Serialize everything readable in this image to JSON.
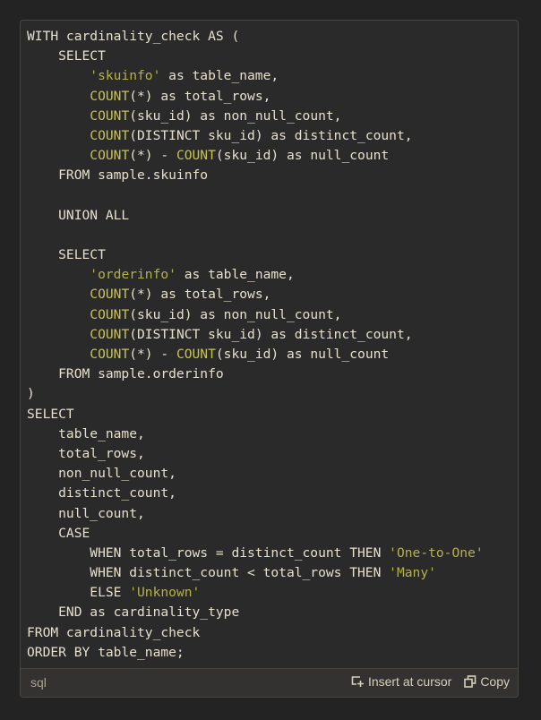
{
  "code_block": {
    "language": "sql",
    "lines": [
      [
        {
          "t": "WITH cardinality_check AS ("
        }
      ],
      [
        {
          "t": "    SELECT"
        }
      ],
      [
        {
          "t": "        "
        },
        {
          "t": "'skuinfo'",
          "c": "str"
        },
        {
          "t": " as table_name,"
        }
      ],
      [
        {
          "t": "        "
        },
        {
          "t": "COUNT",
          "c": "fn"
        },
        {
          "t": "(*) as total_rows,"
        }
      ],
      [
        {
          "t": "        "
        },
        {
          "t": "COUNT",
          "c": "fn"
        },
        {
          "t": "(sku_id) as non_null_count,"
        }
      ],
      [
        {
          "t": "        "
        },
        {
          "t": "COUNT",
          "c": "fn"
        },
        {
          "t": "(DISTINCT sku_id) as distinct_count,"
        }
      ],
      [
        {
          "t": "        "
        },
        {
          "t": "COUNT",
          "c": "fn"
        },
        {
          "t": "(*) - "
        },
        {
          "t": "COUNT",
          "c": "fn"
        },
        {
          "t": "(sku_id) as null_count"
        }
      ],
      [
        {
          "t": "    FROM sample.skuinfo"
        }
      ],
      [
        {
          "t": ""
        }
      ],
      [
        {
          "t": "    UNION ALL"
        }
      ],
      [
        {
          "t": ""
        }
      ],
      [
        {
          "t": "    SELECT"
        }
      ],
      [
        {
          "t": "        "
        },
        {
          "t": "'orderinfo'",
          "c": "str"
        },
        {
          "t": " as table_name,"
        }
      ],
      [
        {
          "t": "        "
        },
        {
          "t": "COUNT",
          "c": "fn"
        },
        {
          "t": "(*) as total_rows,"
        }
      ],
      [
        {
          "t": "        "
        },
        {
          "t": "COUNT",
          "c": "fn"
        },
        {
          "t": "(sku_id) as non_null_count,"
        }
      ],
      [
        {
          "t": "        "
        },
        {
          "t": "COUNT",
          "c": "fn"
        },
        {
          "t": "(DISTINCT sku_id) as distinct_count,"
        }
      ],
      [
        {
          "t": "        "
        },
        {
          "t": "COUNT",
          "c": "fn"
        },
        {
          "t": "(*) - "
        },
        {
          "t": "COUNT",
          "c": "fn"
        },
        {
          "t": "(sku_id) as null_count"
        }
      ],
      [
        {
          "t": "    FROM sample.orderinfo"
        }
      ],
      [
        {
          "t": ")"
        }
      ],
      [
        {
          "t": "SELECT"
        }
      ],
      [
        {
          "t": "    table_name,"
        }
      ],
      [
        {
          "t": "    total_rows,"
        }
      ],
      [
        {
          "t": "    non_null_count,"
        }
      ],
      [
        {
          "t": "    distinct_count,"
        }
      ],
      [
        {
          "t": "    null_count,"
        }
      ],
      [
        {
          "t": "    CASE"
        }
      ],
      [
        {
          "t": "        WHEN total_rows = distinct_count THEN "
        },
        {
          "t": "'One-to-One'",
          "c": "str"
        }
      ],
      [
        {
          "t": "        WHEN distinct_count < total_rows THEN "
        },
        {
          "t": "'Many'",
          "c": "str"
        }
      ],
      [
        {
          "t": "        ELSE "
        },
        {
          "t": "'Unknown'",
          "c": "str"
        }
      ],
      [
        {
          "t": "    END as cardinality_type"
        }
      ],
      [
        {
          "t": "FROM cardinality_check"
        }
      ],
      [
        {
          "t": "ORDER BY table_name;"
        }
      ]
    ]
  },
  "footer": {
    "language_label": "sql",
    "insert_label": "Insert at cursor",
    "insert_icon": "insert-at-cursor-icon",
    "copy_label": "Copy",
    "copy_icon": "copy-icon"
  },
  "colors": {
    "background": "#232323",
    "code_bg": "#2a2a2a",
    "text": "#e6e0cc",
    "function": "#c8c25a",
    "string": "#b3b24a"
  }
}
